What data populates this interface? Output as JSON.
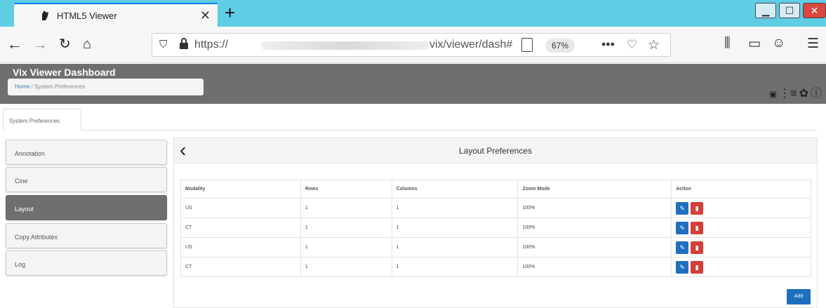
{
  "browser": {
    "tab_title": "HTML5 Viewer",
    "tab_close": "✕",
    "new_tab": "+",
    "url_prefix": "https://",
    "url_suffix": "vix/viewer/dash#",
    "zoom": "67%"
  },
  "app": {
    "title": "Vix Viewer Dashboard",
    "breadcrumb": {
      "home": "Home",
      "separator": "/",
      "current": "System Preferences"
    }
  },
  "page_tabs": [
    "System Preferences"
  ],
  "sidebar": {
    "items": [
      {
        "label": "Annotation",
        "active": false
      },
      {
        "label": "Cine",
        "active": false
      },
      {
        "label": "Layout",
        "active": true
      },
      {
        "label": "Copy Attributes",
        "active": false
      },
      {
        "label": "Log",
        "active": false
      }
    ]
  },
  "panel": {
    "title": "Layout Preferences",
    "columns": [
      "Modality",
      "Rows",
      "Columns",
      "Zoom Mode",
      "Action"
    ],
    "rows": [
      {
        "modality": "US",
        "rows": "1",
        "columns": "1",
        "zoom": "100%"
      },
      {
        "modality": "CT",
        "rows": "1",
        "columns": "1",
        "zoom": "100%"
      },
      {
        "modality": "US",
        "rows": "1",
        "columns": "1",
        "zoom": "100%"
      },
      {
        "modality": "CT",
        "rows": "1",
        "columns": "1",
        "zoom": "100%"
      }
    ],
    "add_label": "Add"
  },
  "colors": {
    "tabstrip": "#5fcde4",
    "header": "#6f6f6f",
    "primary_button": "#1f6fbf",
    "danger_button": "#d43f3a"
  },
  "icons": {
    "tab": "viewer-logo-icon",
    "header": [
      "dicom-tag-icon",
      "list-tree-icon",
      "gear-icon",
      "info-icon"
    ],
    "row_actions": [
      "edit-icon",
      "trash-icon"
    ]
  }
}
